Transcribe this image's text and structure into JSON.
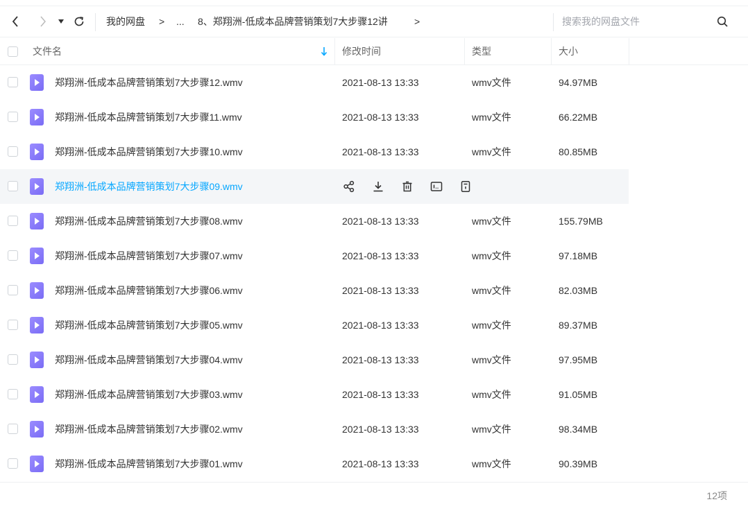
{
  "nav": {
    "back_icon": "chevron-left-icon",
    "forward_icon": "chevron-right-icon",
    "history_icon": "caret-down-icon",
    "refresh_icon": "refresh-icon"
  },
  "breadcrumb": {
    "root": "我的网盘",
    "sep1": ">",
    "ellipsis": "...",
    "current": "8、郑翔洲-低成本品牌营销策划7大步骤12讲",
    "sep2": ">"
  },
  "search": {
    "placeholder": "搜索我的网盘文件",
    "icon": "search-icon"
  },
  "table": {
    "headers": {
      "name": "文件名",
      "modified": "修改时间",
      "type": "类型",
      "size": "大小"
    },
    "sort_icon": "sort-down-arrow-icon",
    "rows": [
      {
        "name": "郑翔洲-低成本品牌营销策划7大步骤12.wmv",
        "modified": "2021-08-13 13:33",
        "type": "wmv文件",
        "size": "94.97MB"
      },
      {
        "name": "郑翔洲-低成本品牌营销策划7大步骤11.wmv",
        "modified": "2021-08-13 13:33",
        "type": "wmv文件",
        "size": "66.22MB"
      },
      {
        "name": "郑翔洲-低成本品牌营销策划7大步骤10.wmv",
        "modified": "2021-08-13 13:33",
        "type": "wmv文件",
        "size": "80.85MB"
      },
      {
        "name": "郑翔洲-低成本品牌营销策划7大步骤09.wmv",
        "modified": "",
        "type": "",
        "size": ""
      },
      {
        "name": "郑翔洲-低成本品牌营销策划7大步骤08.wmv",
        "modified": "2021-08-13 13:33",
        "type": "wmv文件",
        "size": "155.79MB"
      },
      {
        "name": "郑翔洲-低成本品牌营销策划7大步骤07.wmv",
        "modified": "2021-08-13 13:33",
        "type": "wmv文件",
        "size": "97.18MB"
      },
      {
        "name": "郑翔洲-低成本品牌营销策划7大步骤06.wmv",
        "modified": "2021-08-13 13:33",
        "type": "wmv文件",
        "size": "82.03MB"
      },
      {
        "name": "郑翔洲-低成本品牌营销策划7大步骤05.wmv",
        "modified": "2021-08-13 13:33",
        "type": "wmv文件",
        "size": "89.37MB"
      },
      {
        "name": "郑翔洲-低成本品牌营销策划7大步骤04.wmv",
        "modified": "2021-08-13 13:33",
        "type": "wmv文件",
        "size": "97.95MB"
      },
      {
        "name": "郑翔洲-低成本品牌营销策划7大步骤03.wmv",
        "modified": "2021-08-13 13:33",
        "type": "wmv文件",
        "size": "91.05MB"
      },
      {
        "name": "郑翔洲-低成本品牌营销策划7大步骤02.wmv",
        "modified": "2021-08-13 13:33",
        "type": "wmv文件",
        "size": "98.34MB"
      },
      {
        "name": "郑翔洲-低成本品牌营销策划7大步骤01.wmv",
        "modified": "2021-08-13 13:33",
        "type": "wmv文件",
        "size": "90.39MB"
      }
    ],
    "hover_actions": [
      "share-icon",
      "download-icon",
      "delete-icon",
      "rename-icon",
      "more-icon"
    ]
  },
  "footer": {
    "count": "12项"
  },
  "colors": {
    "accent": "#06a7ff",
    "file_icon": "#8a7cf8",
    "hover_row": "#f4f6f8"
  }
}
